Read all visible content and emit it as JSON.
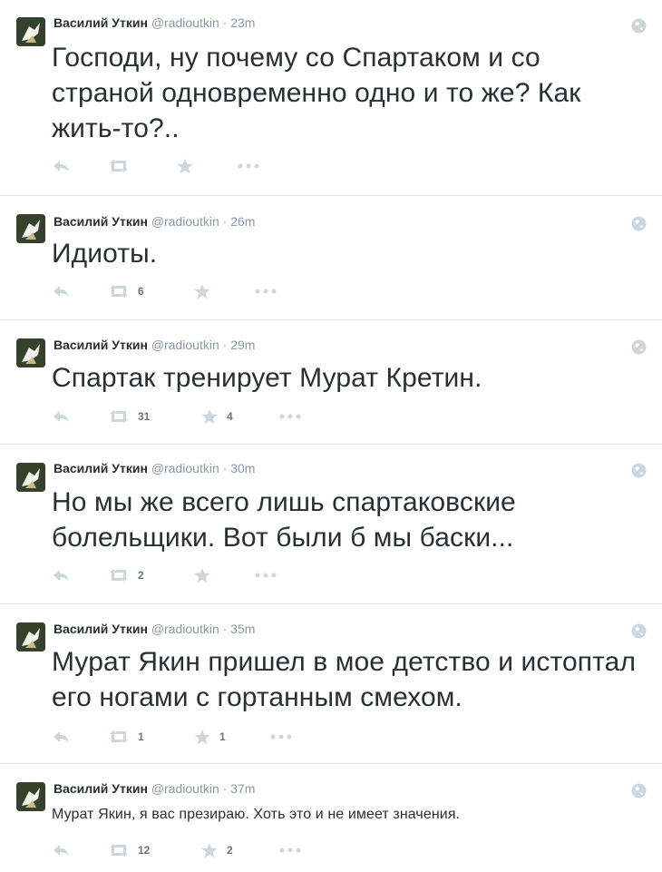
{
  "colors": {
    "icon": "#ccd6dd",
    "text": "#292f33",
    "muted": "#8899a6",
    "divider": "#e1e8ed"
  },
  "icons": [
    "reply-icon",
    "retweet-icon",
    "favorite-icon",
    "more-icon",
    "globe-icon"
  ],
  "tweets": [
    {
      "name": "Василий Уткин",
      "handle": "@radioutkin",
      "sep": "·",
      "time": "23m",
      "text": "Господи, ну почему со Спартаком и со страной одновременно одно и то же? Как жить-то?..",
      "retweets": "",
      "favorites": ""
    },
    {
      "name": "Василий Уткин",
      "handle": "@radioutkin",
      "sep": "·",
      "time": "26m",
      "text": "Идиоты.",
      "retweets": "6",
      "favorites": ""
    },
    {
      "name": "Василий Уткин",
      "handle": "@radioutkin",
      "sep": "·",
      "time": "29m",
      "text": "Спартак тренирует Мурат Кретин.",
      "retweets": "31",
      "favorites": "4"
    },
    {
      "name": "Василий Уткин",
      "handle": "@radioutkin",
      "sep": "·",
      "time": "30m",
      "text": "Но мы же всего лишь спартаковские болельщики. Вот были б мы баски...",
      "retweets": "2",
      "favorites": ""
    },
    {
      "name": "Василий Уткин",
      "handle": "@radioutkin",
      "sep": "·",
      "time": "35m",
      "text": "Мурат Якин пришел в мое детство и истоптал его ногами с гортанным смехом.",
      "retweets": "1",
      "favorites": "1"
    },
    {
      "name": "Василий Уткин",
      "handle": "@radioutkin",
      "sep": "·",
      "time": "37m",
      "text": "Мурат Якин, я вас презираю. Хоть это и не имеет значения.",
      "retweets": "12",
      "favorites": "2"
    }
  ]
}
